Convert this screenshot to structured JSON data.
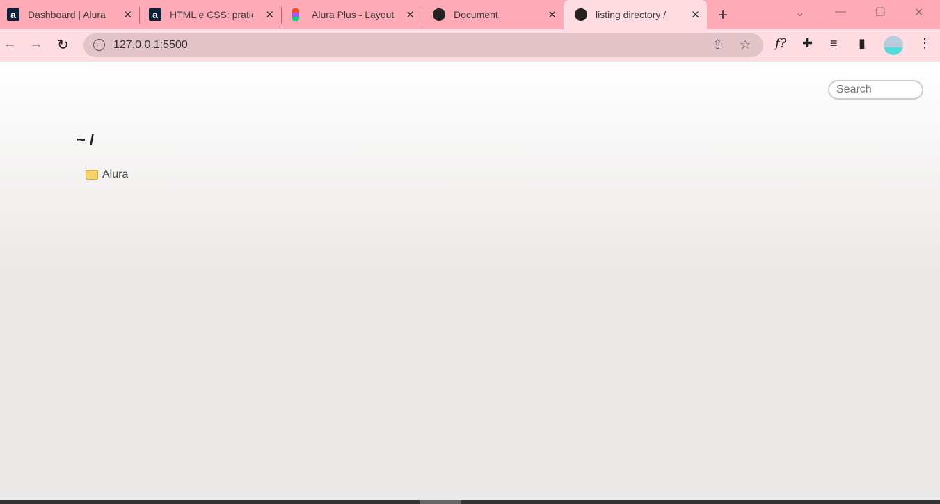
{
  "tabs": [
    {
      "title": "Dashboard | Alura",
      "icon": "alura-icon"
    },
    {
      "title": "HTML e CSS: pratic",
      "icon": "alura-icon"
    },
    {
      "title": "Alura Plus - Layout",
      "icon": "figma-icon"
    },
    {
      "title": "Document",
      "icon": "globe-icon"
    },
    {
      "title": "listing directory /",
      "icon": "globe-icon",
      "active": true
    }
  ],
  "address": {
    "url": "127.0.0.1:5500"
  },
  "page": {
    "search_placeholder": "Search",
    "heading": "~ /",
    "entries": [
      {
        "name": "Alura",
        "type": "folder"
      }
    ]
  }
}
